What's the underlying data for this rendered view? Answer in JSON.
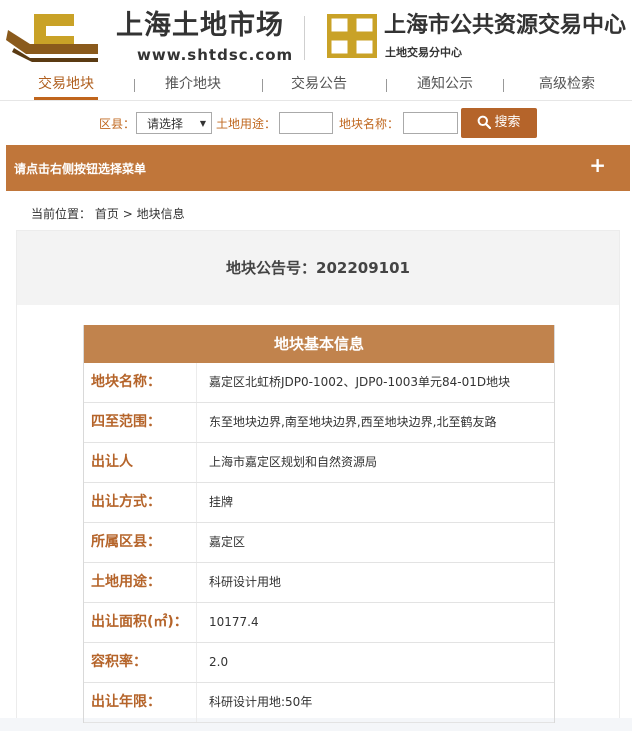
{
  "header": {
    "brand_title": "上海土地市场",
    "brand_url": "www.shtdsc.com",
    "center_title": "上海市公共资源交易中心",
    "center_subtitle": "土地交易分中心"
  },
  "nav": {
    "items": [
      {
        "label": "交易地块"
      },
      {
        "label": "推介地块"
      },
      {
        "label": "交易公告"
      },
      {
        "label": "通知公示"
      },
      {
        "label": "高级检索"
      }
    ]
  },
  "search": {
    "district_label": "区县：",
    "district_value": "请选择",
    "landuse_label": "土地用途：",
    "landname_label": "地块名称：",
    "button_label": "搜索"
  },
  "menubar": {
    "text": "请点击右侧按钮选择菜单",
    "toggle": "+"
  },
  "breadcrumb": {
    "prefix": "当前位置：",
    "home": "首页",
    "separator": ">",
    "current": "地块信息"
  },
  "notice": {
    "title": "地块公告号：202209101"
  },
  "info": {
    "heading": "地块基本信息",
    "rows": [
      {
        "label": "地块名称：",
        "value": "嘉定区北虹桥JDP0-1002、JDP0-1003单元84-01D地块"
      },
      {
        "label": "四至范围：",
        "value": "东至地块边界,南至地块边界,西至地块边界,北至鹤友路"
      },
      {
        "label": "出让人",
        "value": "上海市嘉定区规划和自然资源局"
      },
      {
        "label": "出让方式：",
        "value": "挂牌"
      },
      {
        "label": "所属区县：",
        "value": "嘉定区"
      },
      {
        "label": "土地用途：",
        "value": "科研设计用地"
      },
      {
        "label": "出让面积(㎡)：",
        "value": "10177.4"
      },
      {
        "label": "容积率：",
        "value": "2.0"
      },
      {
        "label": "出让年限：",
        "value": "科研设计用地:50年"
      }
    ]
  },
  "colors": {
    "accent": "#b5642a",
    "menubar": "#c0763a",
    "table_head": "#c1834d",
    "logo_gold": "#c9a227"
  },
  "icons": {
    "search": "search-icon",
    "dropdown": "chevron-down-icon"
  }
}
